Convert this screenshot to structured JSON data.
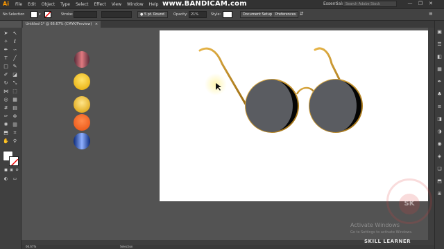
{
  "app": {
    "logo": "Ai",
    "menus": [
      "File",
      "Edit",
      "Object",
      "Type",
      "Select",
      "Effect",
      "View",
      "Window",
      "Help"
    ],
    "overlay_watermark": "www.BANDICAM.com",
    "workspace": "Essentials",
    "search_placeholder": "Search Adobe Stock",
    "window_buttons": [
      "—",
      "❐",
      "✕"
    ]
  },
  "control_bar": {
    "selection_label": "No Selection",
    "stroke_label": "Stroke:",
    "brush_label": "5 pt. Round",
    "opacity_label": "Opacity:",
    "opacity_value": "21%",
    "style_label": "Style:",
    "document_setup": "Document Setup",
    "preferences": "Preferences"
  },
  "document": {
    "tab_title": "Untitled-1* @ 66.67% (CMYK/Preview)",
    "tab_close": "×"
  },
  "status": {
    "zoom": "66.67%",
    "tool": "Selection"
  },
  "swatches": [
    {
      "name": "rose-gradient",
      "c1": "#e07a80",
      "c2": "#5a2c3a"
    },
    {
      "name": "gold-radial",
      "c1": "#ffe36a",
      "c2": "#e5a800"
    },
    {
      "name": "gold-radial-2",
      "c1": "#ffe58a",
      "c2": "#d79a00"
    },
    {
      "name": "orange-radial",
      "c1": "#ff8a4a",
      "c2": "#e84f10"
    },
    {
      "name": "blue-gradient",
      "c1": "#8fb0ff",
      "c2": "#0c2a7a"
    }
  ],
  "colors": {
    "frame_gold_light": "#e8b64a",
    "frame_gold_dark": "#9a6a10",
    "lens_gray": "#5a5c61",
    "lens_black": "#050505",
    "highlight": "#fff6b0"
  },
  "watermark": {
    "activate_title": "Activate Windows",
    "activate_sub": "Go to Settings to activate Windows.",
    "brand": "SKILL LEARNER",
    "logo_letters": "SK"
  }
}
